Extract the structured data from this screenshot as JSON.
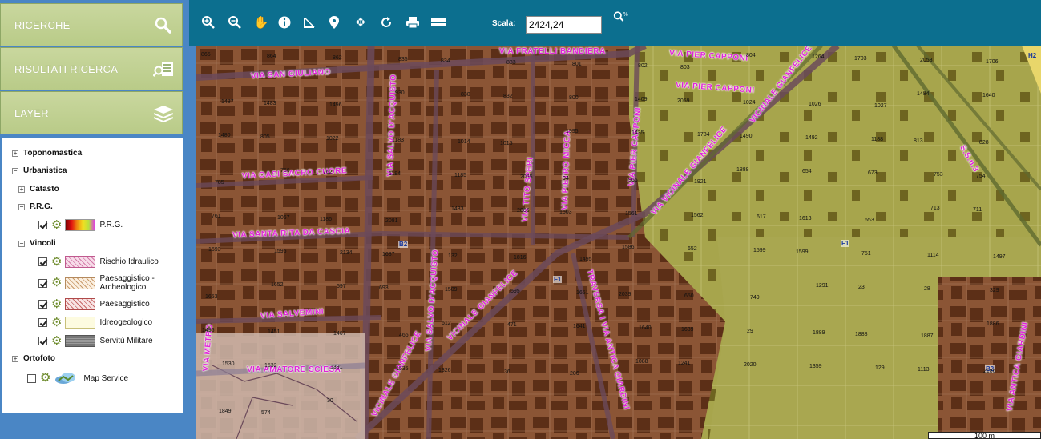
{
  "sidebar": {
    "panels": [
      {
        "label": "RICERCHE",
        "icon": "search-icon"
      },
      {
        "label": "RISULTATI RICERCA",
        "icon": "results-list-icon"
      },
      {
        "label": "LAYER",
        "icon": "layers-icon"
      }
    ],
    "tree": {
      "toponomastica": "Toponomastica",
      "urbanistica": "Urbanistica",
      "catasto": "Catasto",
      "prg_group": "P.R.G.",
      "prg_layer": "P.R.G.",
      "vincoli": "Vincoli",
      "rischio": "Rischio Idraulico",
      "paesaggistico_arch": "Paesaggistico - Archeologico",
      "paesaggistico": "Paesaggistico",
      "idreogeologico": "Idreogeologico",
      "servitu": "Servitù Militare",
      "ortofoto": "Ortofoto",
      "map_service": "Map Service"
    }
  },
  "toolbar": {
    "tools": [
      "zoom-in-icon",
      "zoom-out-icon",
      "pan-hand-icon",
      "info-icon",
      "measure-angle-icon",
      "location-pin-icon",
      "move-icon",
      "refresh-icon",
      "print-icon",
      "ruler-icon"
    ],
    "scale_label": "Scala:",
    "scale_value": "2424,24",
    "zoom_percent_icon": "zoom-percent-icon"
  },
  "map": {
    "streets": {
      "fratelli": "VIA FRATELLI BANDIERA",
      "pier_capponi_1": "VIA PIER CAPPONI",
      "pier_capponi_2": "VIA PIER CAPPONI",
      "san_giuliano": "VIA SAN GIULIANO",
      "salvo_1": "VIA SALVO D'ACQUISTO",
      "oasi": "VIA OASI SACRO CUORE",
      "tito_speri": "VIA TITO SPERI",
      "pietro_micca": "VIA PIETRO MICCA",
      "pier_capponi_v": "VIA PIER CAPPONI",
      "vicinale_gf_1": "VICINALE GIANFELICE",
      "via_vicinale": "VIA VICINALE GIANFELICE",
      "santa_rita": "VIA SANTA RITA DA CASCIA",
      "salvo_2": "VIA SALVO D'ACQUISTO",
      "vicinale_gf_2": "VICINALE GIANFELICE",
      "traversa": "TRAVERSA I VIA ANTICA GIARDINI",
      "salvemini": "VIA SALVEMINI",
      "amatore": "VIA AMATORE SCIESA",
      "vicinale_gf_3": "VICINALE GIANFELICE",
      "antica_giardini": "VIA ANTICA GIARDINI",
      "sp": "S.S.n.3",
      "metro": "VIA METRO"
    },
    "zones": [
      "H2",
      "B2",
      "F1",
      "F1",
      "B2"
    ],
    "numbers": [
      "865",
      "864",
      "862",
      "835",
      "834",
      "833",
      "801",
      "802",
      "803",
      "804",
      "1264",
      "1703",
      "2058",
      "1706",
      "1487",
      "1483",
      "1496",
      "930",
      "830",
      "832",
      "800",
      "1409",
      "2059",
      "1024",
      "1026",
      "1027",
      "1484",
      "1640",
      "1480",
      "805",
      "1022",
      "1183",
      "1014",
      "1015",
      "1995",
      "1435",
      "1784",
      "1490",
      "1492",
      "1188",
      "813",
      "828",
      "785",
      "756",
      "762",
      "1184",
      "1185",
      "2065",
      "94",
      "966",
      "1921",
      "1888",
      "654",
      "673",
      "753",
      "754",
      "761",
      "1067",
      "1186",
      "2081",
      "1433",
      "2066",
      "1603",
      "1561",
      "1562",
      "617",
      "1613",
      "653",
      "713",
      "711",
      "1593",
      "1596",
      "2134",
      "1687",
      "132",
      "1816",
      "1495",
      "1586",
      "652",
      "1599",
      "1599",
      "751",
      "1114",
      "1497",
      "1653",
      "1652",
      "597",
      "693",
      "1509",
      "595",
      "1651",
      "2039",
      "650",
      "749",
      "1291",
      "23",
      "28",
      "329",
      "1496",
      "1451",
      "1467",
      "466",
      "612",
      "471",
      "1641",
      "1640",
      "1639",
      "29",
      "1889",
      "1888",
      "1887",
      "1886",
      "1530",
      "1532",
      "1391",
      "1535",
      "1326",
      "36",
      "206",
      "1088",
      "1241",
      "2020",
      "1359",
      "129",
      "1113",
      "2186",
      "1849",
      "574",
      "30"
    ],
    "scale_bar": "100 m"
  }
}
